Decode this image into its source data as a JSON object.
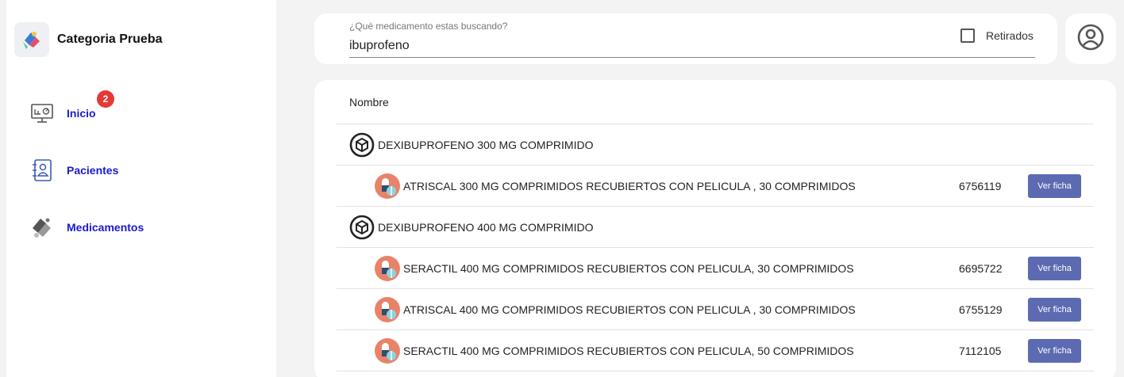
{
  "brand": {
    "name": "Categoria Prueba",
    "icon": "app-logo-icon"
  },
  "sidebar": {
    "items": [
      {
        "label": "Inicio",
        "icon": "dashboard-monitor-icon",
        "badge": "2"
      },
      {
        "label": "Pacientes",
        "icon": "contact-book-icon"
      },
      {
        "label": "Medicamentos",
        "icon": "pills-icon"
      }
    ]
  },
  "search": {
    "label": "¿Qué medicamento estas buscando?",
    "value": "ibuprofeno",
    "retirados_label": "Retirados",
    "retirados_checked": false
  },
  "user": {
    "icon": "account-circle-icon"
  },
  "table": {
    "column_header": "Nombre",
    "button_label": "Ver ficha",
    "rows": [
      {
        "type": "group",
        "name": "DEXIBUPROFENO 300 MG COMPRIMIDO",
        "icon": "box-icon"
      },
      {
        "type": "item",
        "name": "ATRISCAL 300 MG COMPRIMIDOS RECUBIERTOS CON PELICULA , 30 COMPRIMIDOS",
        "code": "6756119",
        "icon": "capsule-icon"
      },
      {
        "type": "group",
        "name": "DEXIBUPROFENO 400 MG COMPRIMIDO",
        "icon": "box-icon"
      },
      {
        "type": "item",
        "name": "SERACTIL 400 MG COMPRIMIDOS RECUBIERTOS CON PELICULA, 30 COMPRIMIDOS",
        "code": "6695722",
        "icon": "capsule-icon"
      },
      {
        "type": "item",
        "name": "ATRISCAL 400 MG COMPRIMIDOS RECUBIERTOS CON PELICULA , 30 COMPRIMIDOS",
        "code": "6755129",
        "icon": "capsule-icon"
      },
      {
        "type": "item",
        "name": "SERACTIL 400 MG COMPRIMIDOS RECUBIERTOS CON PELICULA, 50 COMPRIMIDOS",
        "code": "7112105",
        "icon": "capsule-icon"
      }
    ]
  },
  "colors": {
    "nav_text": "#1a1acc",
    "badge": "#e53935",
    "button": "#5c6bb1",
    "capsule_bg": "#e8836a"
  }
}
